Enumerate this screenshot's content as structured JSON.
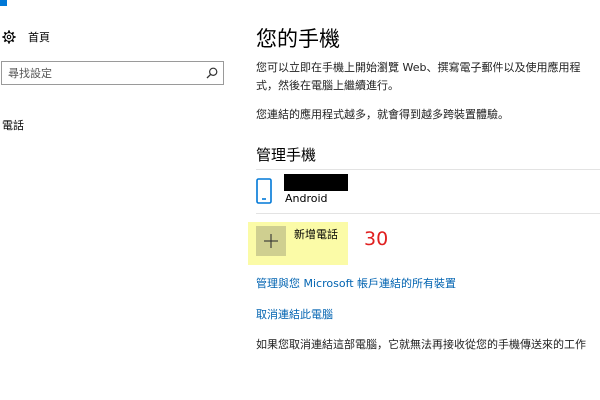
{
  "sidebar": {
    "home_label": "首頁",
    "search_placeholder": "尋找設定",
    "items": [
      {
        "label": "電話"
      }
    ]
  },
  "main": {
    "title": "您的手機",
    "description": "您可以立即在手機上開始瀏覽 Web、撰寫電子郵件以及使用應用程式，然後在電腦上繼續進行。",
    "description2": "您連結的應用程式越多，就會得到越多跨裝置體驗。",
    "manage_heading": "管理手機",
    "device": {
      "name": "",
      "name_redacted": true,
      "os": "Android"
    },
    "add_phone_label": "新增電話",
    "annotation_number": "30",
    "links": {
      "manage": "管理與您 Microsoft 帳戶連結的所有裝置",
      "unlink": "取消連結此電腦"
    },
    "footer_text": "如果您取消連結這部電腦，它就無法再接收從您的手機傳送來的工作"
  },
  "colors": {
    "accent": "#0078d7",
    "link": "#0063b1",
    "highlight": "#fbfba7",
    "annotation": "#e02020"
  },
  "icons": {
    "home": "gear-icon",
    "search": "search-icon",
    "device": "phone-icon",
    "add": "plus-icon"
  }
}
